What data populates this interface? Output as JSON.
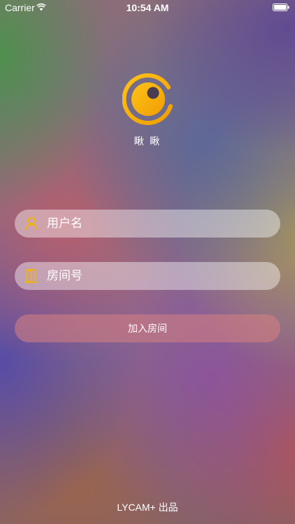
{
  "status_bar": {
    "carrier": "Carrier",
    "time": "10:54 AM",
    "icons": [
      "wifi-icon",
      "battery-icon"
    ]
  },
  "app": {
    "name": "瞅 瞅",
    "logo_icon": "eye-logo-icon",
    "brand_color": "#f5b400"
  },
  "form": {
    "username": {
      "placeholder": "用户名",
      "value": "",
      "icon": "user-icon"
    },
    "room": {
      "placeholder": "房间号",
      "value": "",
      "icon": "door-icon"
    },
    "join_label": "加入房间"
  },
  "footer": {
    "credit": "LYCAM+ 出品"
  }
}
